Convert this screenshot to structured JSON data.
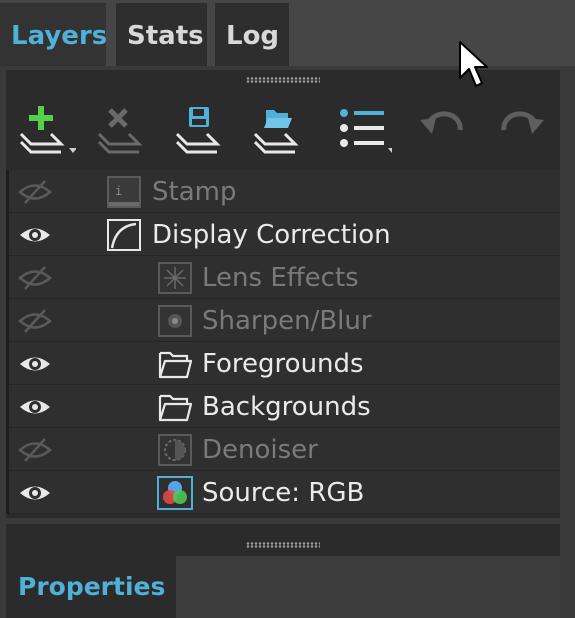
{
  "tabs": [
    {
      "label": "Layers",
      "active": true
    },
    {
      "label": "Stats",
      "active": false
    },
    {
      "label": "Log",
      "active": false
    }
  ],
  "toolbar": [
    {
      "icon": "add-layer-icon",
      "enabled": true
    },
    {
      "icon": "delete-layer-icon",
      "enabled": false
    },
    {
      "icon": "save-layers-icon",
      "enabled": true
    },
    {
      "icon": "open-layers-icon",
      "enabled": true
    },
    {
      "icon": "list-menu-icon",
      "enabled": true
    },
    {
      "icon": "undo-icon",
      "enabled": false
    },
    {
      "icon": "redo-icon",
      "enabled": false
    }
  ],
  "layers": [
    {
      "name": "Stamp",
      "visible": false,
      "icon": "stamp-icon"
    },
    {
      "name": "Display Correction",
      "visible": true,
      "icon": "curve-icon"
    },
    {
      "name": "Lens Effects",
      "visible": false,
      "icon": "lens-effects-icon"
    },
    {
      "name": "Sharpen/Blur",
      "visible": false,
      "icon": "sharpen-blur-icon"
    },
    {
      "name": "Foregrounds",
      "visible": true,
      "icon": "folder-icon"
    },
    {
      "name": "Backgrounds",
      "visible": true,
      "icon": "folder-icon"
    },
    {
      "name": "Denoiser",
      "visible": false,
      "icon": "denoiser-icon"
    },
    {
      "name": "Source: RGB",
      "visible": true,
      "icon": "rgb-source-icon"
    }
  ],
  "properties": {
    "label": "Properties"
  },
  "colors": {
    "accent": "#4fb0d8",
    "add_green": "#55d04a",
    "disabled_text": "#7a7a7a"
  }
}
